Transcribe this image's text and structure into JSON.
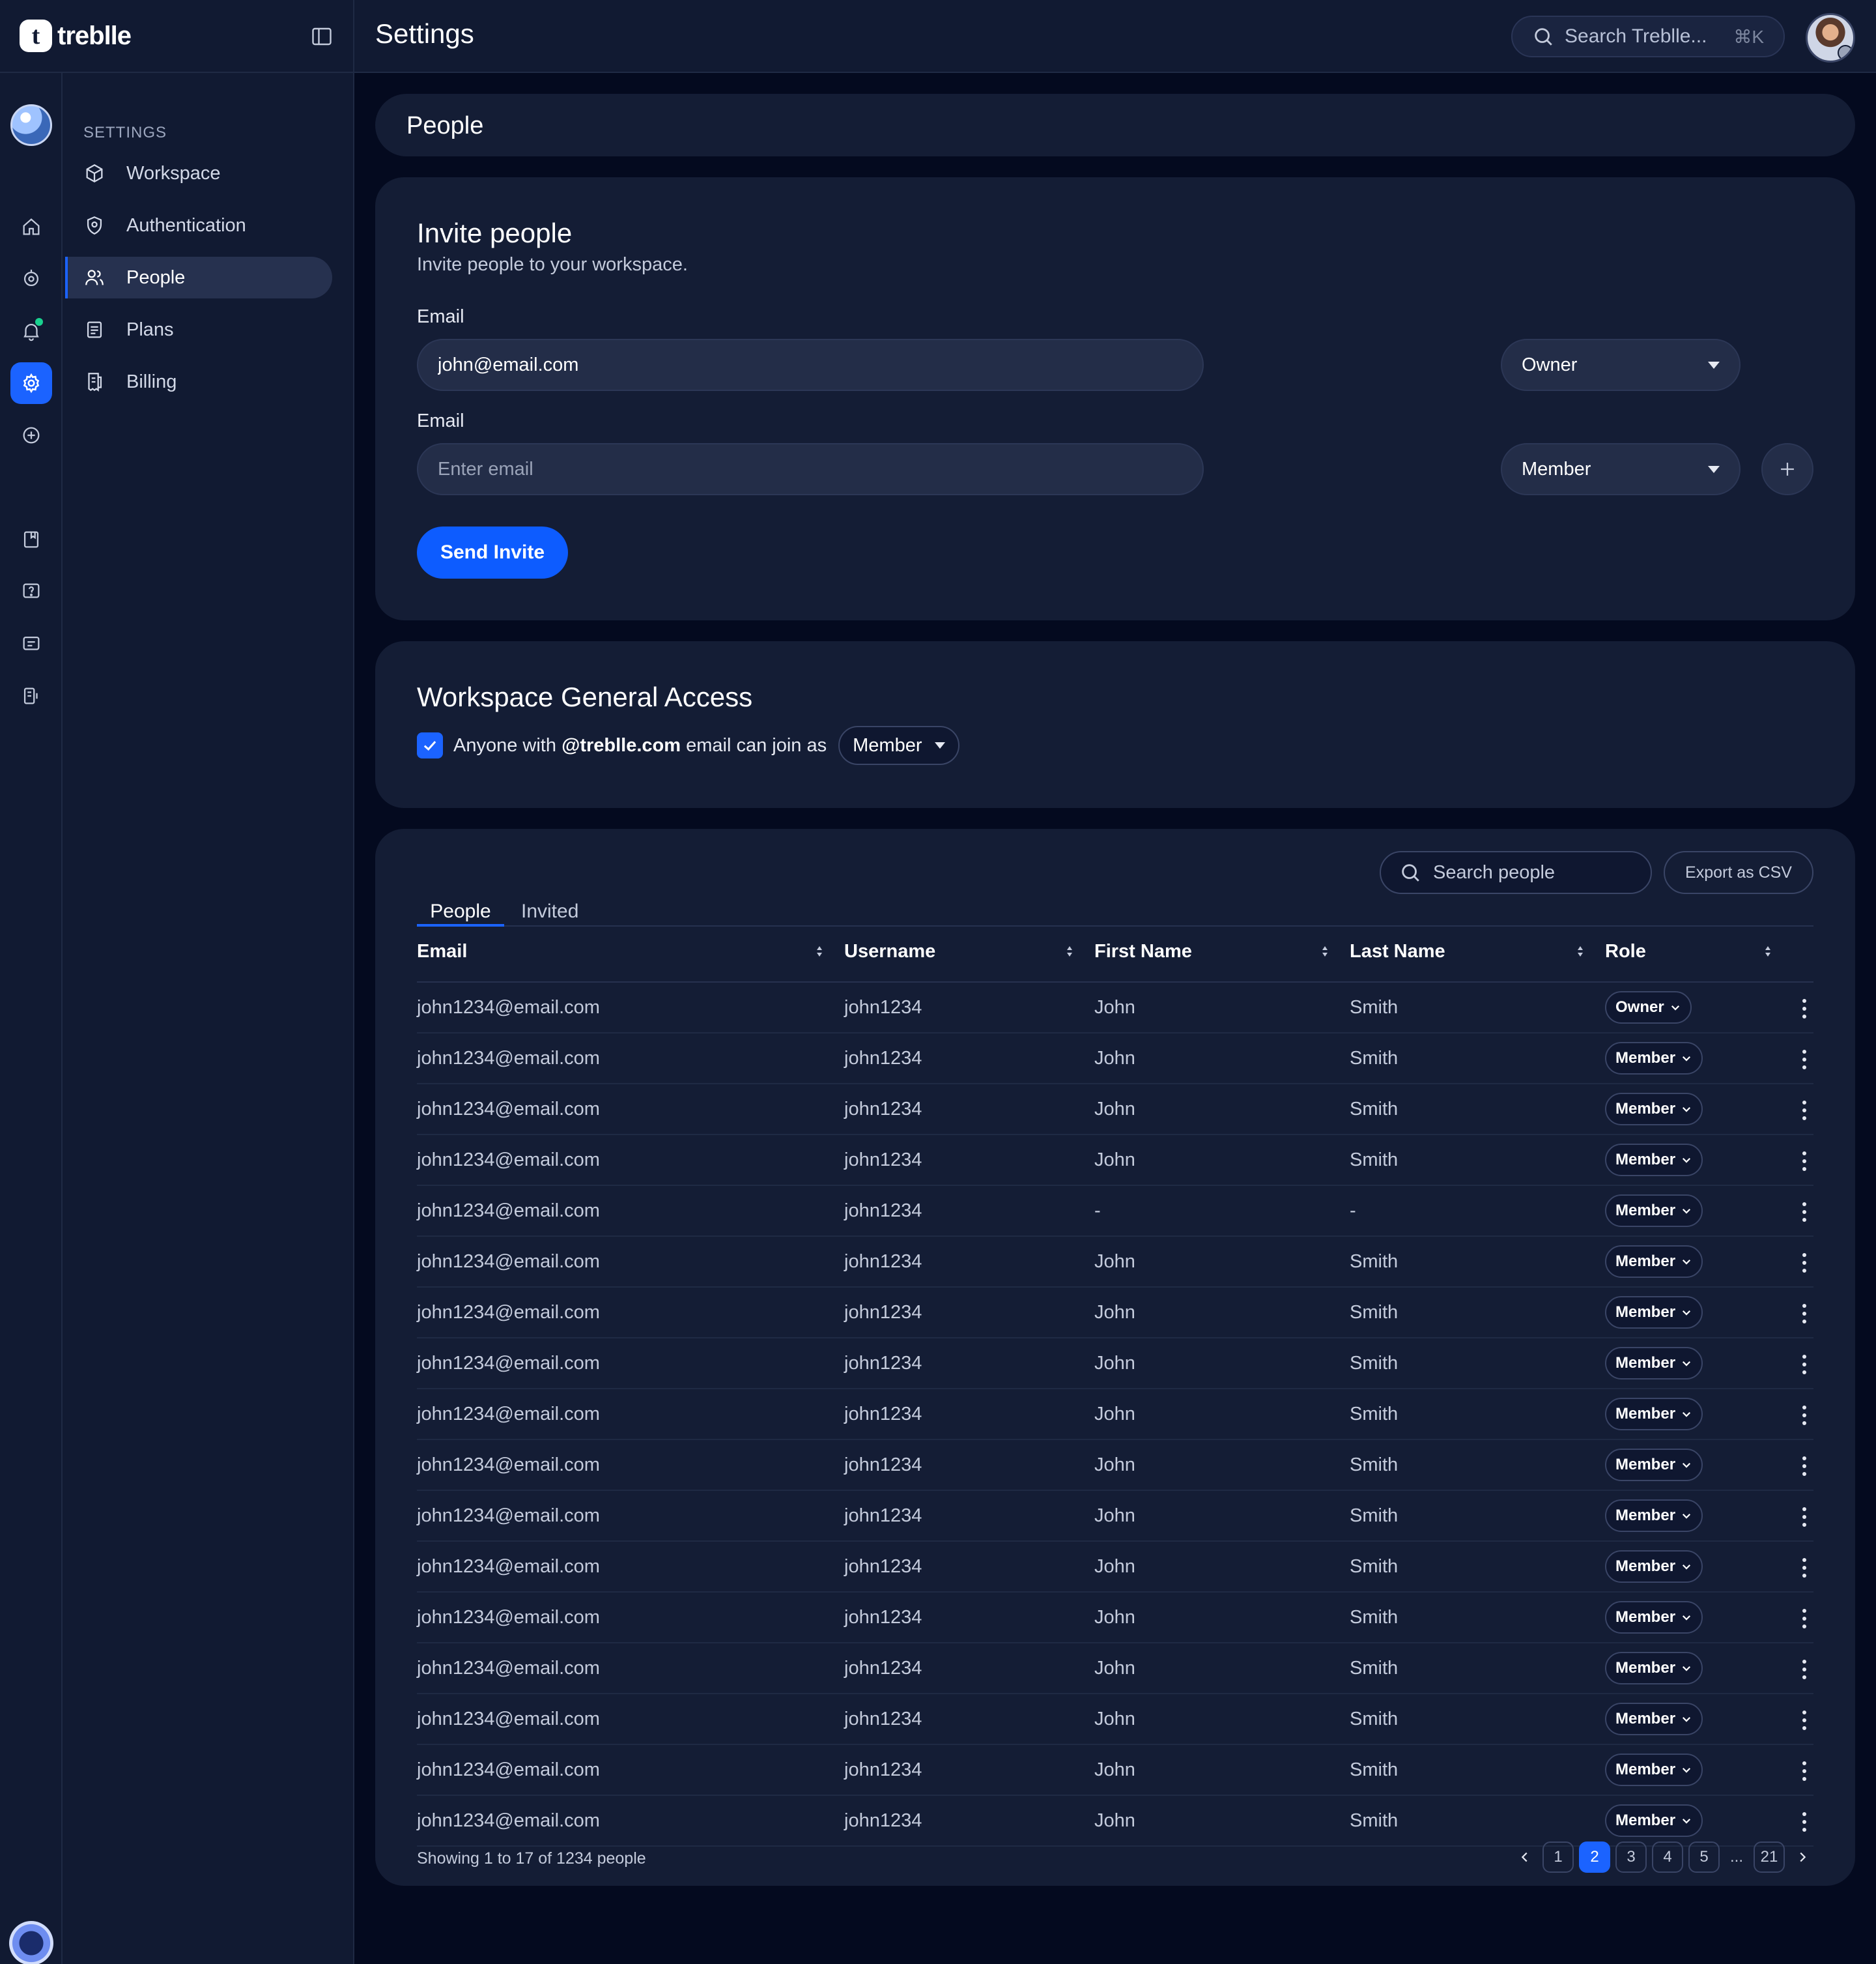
{
  "app": {
    "name": "treblle",
    "logo_letter": "t"
  },
  "header": {
    "title": "Settings",
    "search_placeholder": "Search Treblle...",
    "search_shortcut": "⌘K"
  },
  "rail": {
    "icons": [
      "home-icon",
      "api-icon",
      "notifications-icon",
      "settings-icon",
      "add-icon",
      "docs-icon",
      "help-icon",
      "feedback-icon",
      "integrations-icon"
    ],
    "active": "settings-icon"
  },
  "sidebar": {
    "section_label": "SETTINGS",
    "items": [
      {
        "label": "Workspace",
        "icon": "cube-icon"
      },
      {
        "label": "Authentication",
        "icon": "shield-icon"
      },
      {
        "label": "People",
        "icon": "users-icon",
        "active": true
      },
      {
        "label": "Plans",
        "icon": "document-icon"
      },
      {
        "label": "Billing",
        "icon": "receipt-icon"
      }
    ]
  },
  "page": {
    "title": "People"
  },
  "invite": {
    "title": "Invite people",
    "subtitle": "Invite people to your workspace.",
    "rows": [
      {
        "label": "Email",
        "value": "john@email.com",
        "placeholder": "Enter email",
        "role": "Owner"
      },
      {
        "label": "Email",
        "value": "",
        "placeholder": "Enter email",
        "role": "Member"
      }
    ],
    "send_label": "Send Invite"
  },
  "access": {
    "title": "Workspace General Access",
    "checked": true,
    "text_before": "Anyone with",
    "domain": "@treblle.com",
    "text_after": "email can join as",
    "role": "Member"
  },
  "people_table": {
    "tabs": [
      "People",
      "Invited"
    ],
    "active_tab": "People",
    "search_placeholder": "Search people",
    "export_label": "Export as CSV",
    "columns": [
      "Email",
      "Username",
      "First Name",
      "Last Name",
      "Role"
    ],
    "rows": [
      [
        "john1234@email.com",
        "john1234",
        "John",
        "Smith",
        "Owner"
      ],
      [
        "john1234@email.com",
        "john1234",
        "John",
        "Smith",
        "Member"
      ],
      [
        "john1234@email.com",
        "john1234",
        "John",
        "Smith",
        "Member"
      ],
      [
        "john1234@email.com",
        "john1234",
        "John",
        "Smith",
        "Member"
      ],
      [
        "john1234@email.com",
        "john1234",
        "-",
        "-",
        "Member"
      ],
      [
        "john1234@email.com",
        "john1234",
        "John",
        "Smith",
        "Member"
      ],
      [
        "john1234@email.com",
        "john1234",
        "John",
        "Smith",
        "Member"
      ],
      [
        "john1234@email.com",
        "john1234",
        "John",
        "Smith",
        "Member"
      ],
      [
        "john1234@email.com",
        "john1234",
        "John",
        "Smith",
        "Member"
      ],
      [
        "john1234@email.com",
        "john1234",
        "John",
        "Smith",
        "Member"
      ],
      [
        "john1234@email.com",
        "john1234",
        "John",
        "Smith",
        "Member"
      ],
      [
        "john1234@email.com",
        "john1234",
        "John",
        "Smith",
        "Member"
      ],
      [
        "john1234@email.com",
        "john1234",
        "John",
        "Smith",
        "Member"
      ],
      [
        "john1234@email.com",
        "john1234",
        "John",
        "Smith",
        "Member"
      ],
      [
        "john1234@email.com",
        "john1234",
        "John",
        "Smith",
        "Member"
      ],
      [
        "john1234@email.com",
        "john1234",
        "John",
        "Smith",
        "Member"
      ],
      [
        "john1234@email.com",
        "john1234",
        "John",
        "Smith",
        "Member"
      ]
    ],
    "footer": "Showing 1 to 17 of 1234 people",
    "pages": [
      "1",
      "2",
      "3",
      "4",
      "5",
      "...",
      "21"
    ],
    "current_page": "2"
  },
  "colors": {
    "accent": "#1b63ff",
    "background": "#040a1f",
    "card": "#141d35",
    "status_dot": "#19d18f"
  }
}
